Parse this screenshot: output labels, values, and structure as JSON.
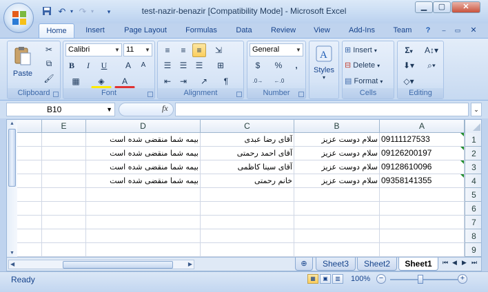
{
  "window": {
    "title": "test-nazir-benazir  [Compatibility Mode] - Microsoft Excel"
  },
  "qat": {
    "save_icon": "save-icon",
    "undo_icon": "undo-icon",
    "redo_icon": "redo-icon"
  },
  "tabs": [
    "Home",
    "Insert",
    "Page Layout",
    "Formulas",
    "Data",
    "Review",
    "View",
    "Add-Ins",
    "Team"
  ],
  "active_tab": "Home",
  "ribbon": {
    "clipboard": {
      "paste_label": "Paste",
      "caption": "Clipboard"
    },
    "font": {
      "font_name": "Calibri",
      "font_size": "11",
      "bold": "B",
      "italic": "I",
      "underline": "U",
      "grow": "A",
      "shrink": "A",
      "color_a": "A",
      "caption": "Font"
    },
    "alignment": {
      "caption": "Alignment"
    },
    "number": {
      "format": "General",
      "percent": "%",
      "comma": ",",
      "caption": "Number"
    },
    "styles": {
      "label": "Styles"
    },
    "cells": {
      "insert": "Insert",
      "delete": "Delete",
      "format": "Format",
      "caption": "Cells"
    },
    "editing": {
      "sigma": "Σ",
      "caption": "Editing"
    }
  },
  "formula_bar": {
    "name_box": "B10",
    "fx": "fx",
    "value": ""
  },
  "columns": [
    "E",
    "D",
    "C",
    "B",
    "A"
  ],
  "rows": [
    {
      "num": "1",
      "A": "09111127533",
      "B": "سلام دوست عزیز",
      "C": "آقای رضا عبدی",
      "D": "بیمه شما منقضی شده است",
      "E": "",
      "flag": true
    },
    {
      "num": "2",
      "A": "09126200197",
      "B": "سلام دوست عزیز",
      "C": "آقای احمد رحمتی",
      "D": "بیمه شما منقضی شده است",
      "E": "",
      "flag": true
    },
    {
      "num": "3",
      "A": "09128610096",
      "B": "سلام دوست عزیز",
      "C": "آقای سینا کاظمی",
      "D": "بیمه شما منقضی شده است",
      "E": "",
      "flag": true
    },
    {
      "num": "4",
      "A": "09358141355",
      "B": "سلام دوست عزیز",
      "C": "خانم رحمتی",
      "D": "بیمه شما منقضی شده است",
      "E": "",
      "flag": true
    },
    {
      "num": "5",
      "A": "",
      "B": "",
      "C": "",
      "D": "",
      "E": "",
      "flag": false
    },
    {
      "num": "6",
      "A": "",
      "B": "",
      "C": "",
      "D": "",
      "E": "",
      "flag": false
    },
    {
      "num": "7",
      "A": "",
      "B": "",
      "C": "",
      "D": "",
      "E": "",
      "flag": false
    },
    {
      "num": "8",
      "A": "",
      "B": "",
      "C": "",
      "D": "",
      "E": "",
      "flag": false
    },
    {
      "num": "9",
      "A": "",
      "B": "",
      "C": "",
      "D": "",
      "E": "",
      "flag": false
    }
  ],
  "sheet_tabs": [
    "Sheet3",
    "Sheet2",
    "Sheet1"
  ],
  "active_sheet": "Sheet1",
  "status": {
    "text": "Ready",
    "zoom": "100%",
    "zoom_out": "−",
    "zoom_in": "+"
  },
  "colors": {
    "ribbon": "#bfd3ee",
    "accent": "#15428b",
    "flag": "#1e8c2a"
  }
}
